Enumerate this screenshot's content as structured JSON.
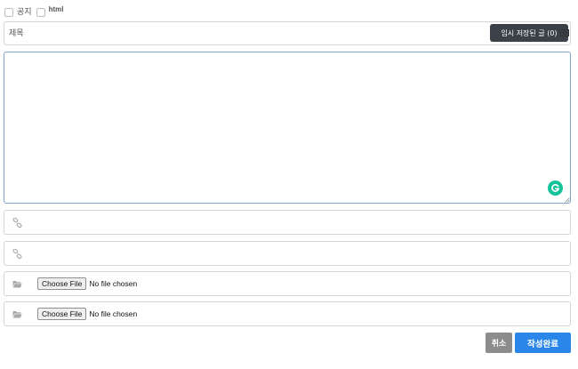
{
  "options": {
    "notice_label": "공지",
    "html_label": "html"
  },
  "title_field": {
    "placeholder": "제목",
    "value": ""
  },
  "temp_saved_button": "임시 저장된 글 (0)",
  "editor": {
    "content": "",
    "grammarly_icon": "grammarly-icon"
  },
  "links": [
    {
      "value": "",
      "icon": "link-icon"
    },
    {
      "value": "",
      "icon": "link-icon"
    }
  ],
  "files": [
    {
      "button": "Choose File",
      "status": "No file chosen",
      "icon": "folder-icon"
    },
    {
      "button": "Choose File",
      "status": "No file chosen",
      "icon": "folder-icon"
    }
  ],
  "actions": {
    "cancel": "취소",
    "submit": "작성완료"
  },
  "colors": {
    "temp_button_bg": "#3b4148",
    "cancel_bg": "#8c8c8c",
    "submit_bg": "#2a86e8",
    "grammarly": "#15c39a"
  }
}
